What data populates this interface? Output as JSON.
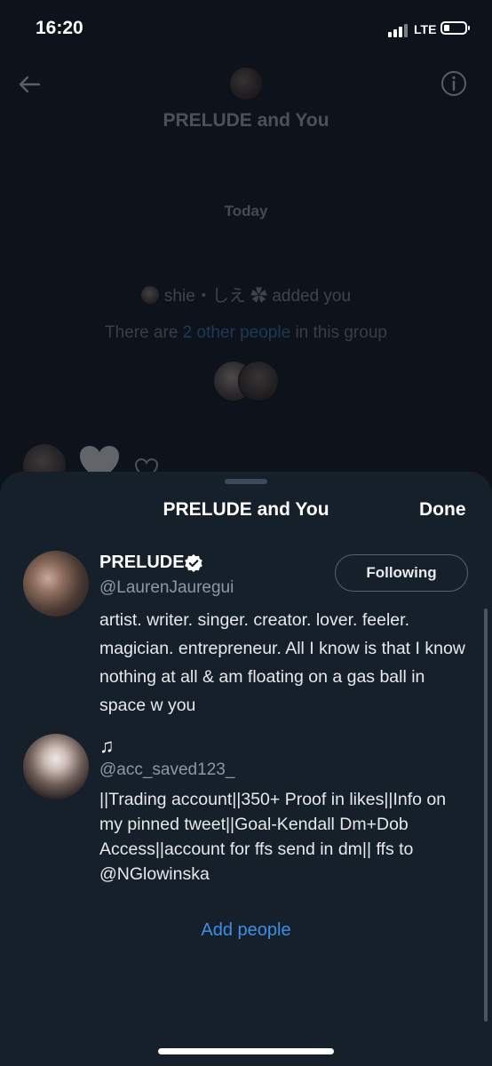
{
  "status_bar": {
    "time": "16:20",
    "network": "LTE"
  },
  "conversation": {
    "title": "PRELUDE and You",
    "date_separator": "Today",
    "added_text": "shie・しえ ✿ added you",
    "group_text_before": "There are ",
    "group_link": "2 other people",
    "group_text_after": " in this group"
  },
  "sheet": {
    "title": "PRELUDE and You",
    "done_label": "Done",
    "members": [
      {
        "name": "PRELUDE",
        "verified": true,
        "handle": "@LaurenJauregui",
        "follow_label": "Following",
        "bio": "artist. writer. singer. creator. lover. feeler. magician. entrepreneur. All I know is that I know nothing at all & am floating on a gas ball in space w you"
      },
      {
        "name": "♫",
        "handle": "@acc_saved123_",
        "bio": "||Trading account||350+ Proof in likes||Info on my pinned tweet||Goal-Kendall Dm+Dob Access||account for ffs send in dm|| ffs to @NGlowinska"
      }
    ],
    "add_people_label": "Add people"
  },
  "colors": {
    "sheet_background": "#15202b",
    "accent": "#3b8fe6",
    "verified_badge": "#ffffff"
  }
}
